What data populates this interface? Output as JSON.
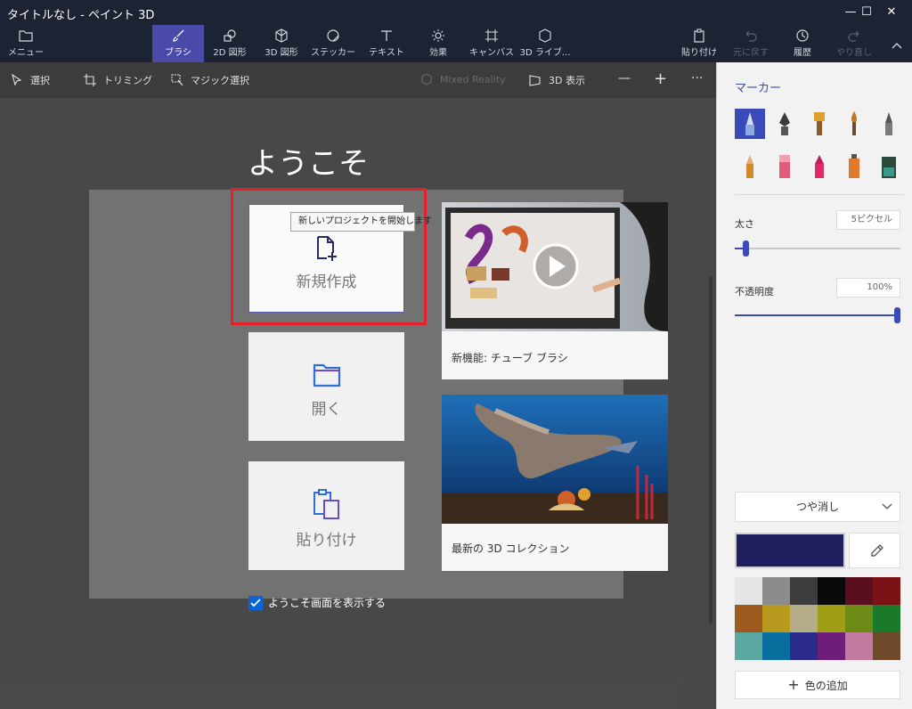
{
  "window": {
    "title": "タイトルなし - ペイント 3D",
    "minimize_glyph": "—",
    "maximize_glyph": "☐",
    "close_glyph": "✕"
  },
  "toolbar": {
    "menu": "メニュー",
    "tools": [
      {
        "label": "ブラシ",
        "icon": "brush-icon",
        "active": true
      },
      {
        "label": "2D 図形",
        "icon": "2d-shapes-icon"
      },
      {
        "label": "3D 図形",
        "icon": "3d-shapes-icon"
      },
      {
        "label": "ステッカー",
        "icon": "sticker-icon"
      },
      {
        "label": "テキスト",
        "icon": "text-icon"
      },
      {
        "label": "効果",
        "icon": "effects-icon"
      },
      {
        "label": "キャンバス",
        "icon": "canvas-icon"
      },
      {
        "label": "3D ライブ...",
        "icon": "3d-library-icon"
      }
    ],
    "paste": "貼り付け",
    "undo": "元に戻す",
    "history": "履歴",
    "redo": "やり直し"
  },
  "subbar": {
    "select": "選択",
    "crop": "トリミング",
    "magic_select": "マジック選択",
    "mixed_reality": "Mixed Reality",
    "view_3d": "3D 表示",
    "zoom_out": "—",
    "zoom_in": "+",
    "more": "···"
  },
  "welcome": {
    "title": "ようこそ",
    "new": "新規作成",
    "new_tooltip": "新しいプロジェクトを開始します",
    "open": "開く",
    "paste": "貼り付け",
    "feature_caption": "新機能: チューブ ブラシ",
    "collection_caption": "最新の 3D コレクション",
    "show_welcome": "ようこそ画面を表示する",
    "show_welcome_checked": true
  },
  "panel": {
    "title": "マーカー",
    "thickness_label": "太さ",
    "thickness_value": "5ピクセル",
    "thickness_fraction": 0.05,
    "opacity_label": "不透明度",
    "opacity_value": "100%",
    "opacity_fraction": 1.0,
    "finish": "つや消し",
    "current_color": "#1f1f5e",
    "add_color": "色の追加",
    "brushes": [
      "marker",
      "calligraphy-pen",
      "oil-brush",
      "watercolor",
      "pixel-pen",
      "pencil",
      "eraser",
      "crayon",
      "spray-can",
      "fill"
    ],
    "swatches": [
      "#e6e6e6",
      "#8c8c8c",
      "#3c3c3c",
      "#0a0a0a",
      "#5a0f1e",
      "#7a1216",
      "#9e5a1e",
      "#b89a1e",
      "#b5ad8a",
      "#9e9e16",
      "#6e8a16",
      "#1a7a2a",
      "#5aa8a0",
      "#0a6e9e",
      "#2a2a8a",
      "#6e1e7a",
      "#c27aa0",
      "#6e4a2a"
    ]
  }
}
